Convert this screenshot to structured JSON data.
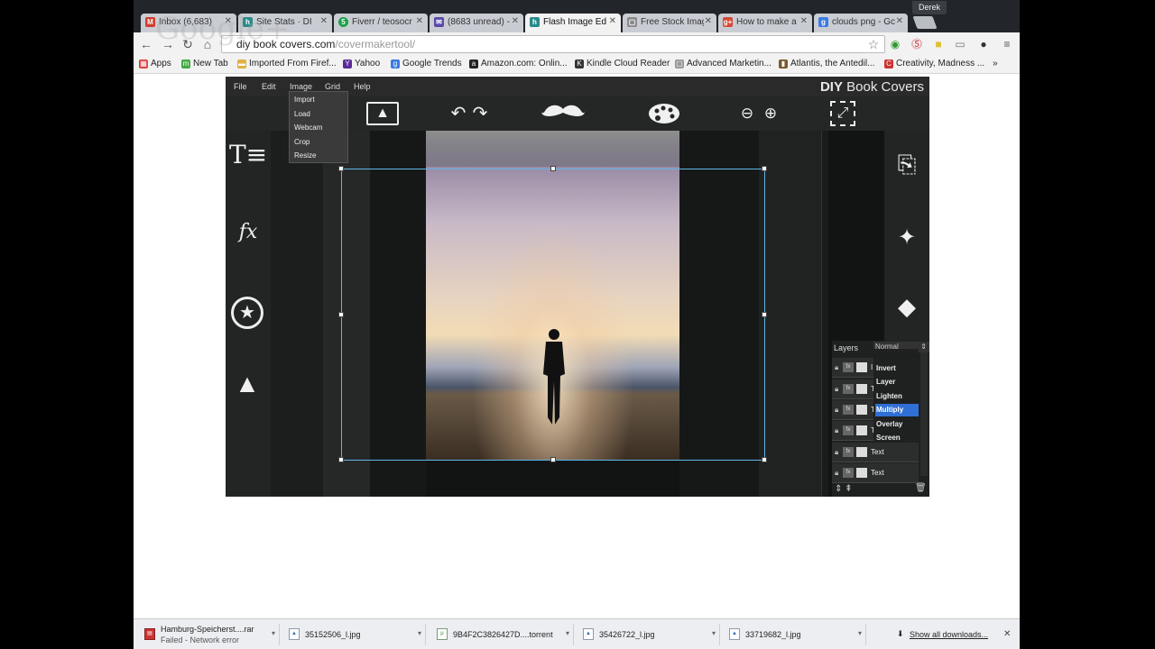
{
  "browser": {
    "user": "Derek",
    "tabs": [
      {
        "title": "Inbox (6,683)",
        "icon": "gmail-icon",
        "letter": "M",
        "color": "#d33c2c"
      },
      {
        "title": "Site Stats · DI",
        "icon": "stats-icon",
        "letter": "h",
        "color": "#2a8a8a"
      },
      {
        "title": "Fiverr / teosocr",
        "icon": "fiverr-icon",
        "letter": "5",
        "color": "#1aa149"
      },
      {
        "title": "(8683 unread) -",
        "icon": "mail-icon",
        "letter": "✉",
        "color": "#5a4aa8"
      },
      {
        "title": "Flash Image Edi",
        "icon": "stats-icon",
        "letter": "h",
        "color": "#2a8a8a"
      },
      {
        "title": "Free Stock Imag",
        "icon": "page-icon",
        "letter": "▢",
        "color": "#8a8a8a"
      },
      {
        "title": "How to make a",
        "icon": "google-icon",
        "letter": "g+",
        "color": "#d34836"
      },
      {
        "title": "clouds png - Gc",
        "icon": "google-search-icon",
        "letter": "g",
        "color": "#3b7be3"
      }
    ],
    "url_host": "diybookcovers.com",
    "url_path": "/covermakertool/",
    "url_display_host": "diy book covers.com",
    "watermark": "Google+",
    "bookmarks": [
      {
        "label": "Apps",
        "icon": "apps-icon",
        "color": "#d44"
      },
      {
        "label": "New Tab",
        "icon": "new-tab-icon",
        "color": "#4a4"
      },
      {
        "label": "Imported From Firef...",
        "icon": "folder-icon",
        "color": "#e0b040"
      },
      {
        "label": "Yahoo",
        "icon": "yahoo-icon",
        "color": "#5a2a9a"
      },
      {
        "label": "Google Trends",
        "icon": "google-search-icon",
        "color": "#3b7be3"
      },
      {
        "label": "Amazon.com: Onlin...",
        "icon": "amazon-icon",
        "color": "#222"
      },
      {
        "label": "Kindle Cloud Reader",
        "icon": "kindle-icon",
        "color": "#333"
      },
      {
        "label": "Advanced Marketin...",
        "icon": "page-icon",
        "color": "#999"
      },
      {
        "label": "Atlantis, the Antedil...",
        "icon": "book-icon",
        "color": "#7a5a2a"
      },
      {
        "label": "Creativity, Madness ...",
        "icon": "c-icon",
        "color": "#c33"
      }
    ],
    "more_bookmarks": "»"
  },
  "app": {
    "brand_bold": "DIY",
    "brand_rest": "Book Covers",
    "menu": [
      "File",
      "Edit",
      "Image",
      "Grid",
      "Help"
    ],
    "image_menu": [
      "Import",
      "Load",
      "Webcam",
      "Crop",
      "Resize"
    ],
    "layers": {
      "title": "Layers",
      "blend_selected": "Normal",
      "blend_modes": [
        "Invert",
        "Layer",
        "Lighten",
        "Multiply",
        "Overlay",
        "Screen"
      ],
      "highlighted": "Multiply",
      "rows": [
        {
          "name": "I"
        },
        {
          "name": "T"
        },
        {
          "name": "T"
        },
        {
          "name": "T"
        },
        {
          "name": "Text"
        },
        {
          "name": "Text"
        }
      ]
    }
  },
  "downloads": {
    "items": [
      {
        "name": "Hamburg-Speicherst....rar",
        "status": "Failed - Network error",
        "icon": "rar-icon"
      },
      {
        "name": "35152506_l.jpg",
        "status": "",
        "icon": "image-file-icon"
      },
      {
        "name": "9B4F2C3826427D....torrent",
        "status": "",
        "icon": "torrent-icon"
      },
      {
        "name": "35426722_l.jpg",
        "status": "",
        "icon": "image-file-icon"
      },
      {
        "name": "33719682_l.jpg",
        "status": "",
        "icon": "image-file-icon"
      }
    ],
    "show_all": "Show all downloads..."
  }
}
